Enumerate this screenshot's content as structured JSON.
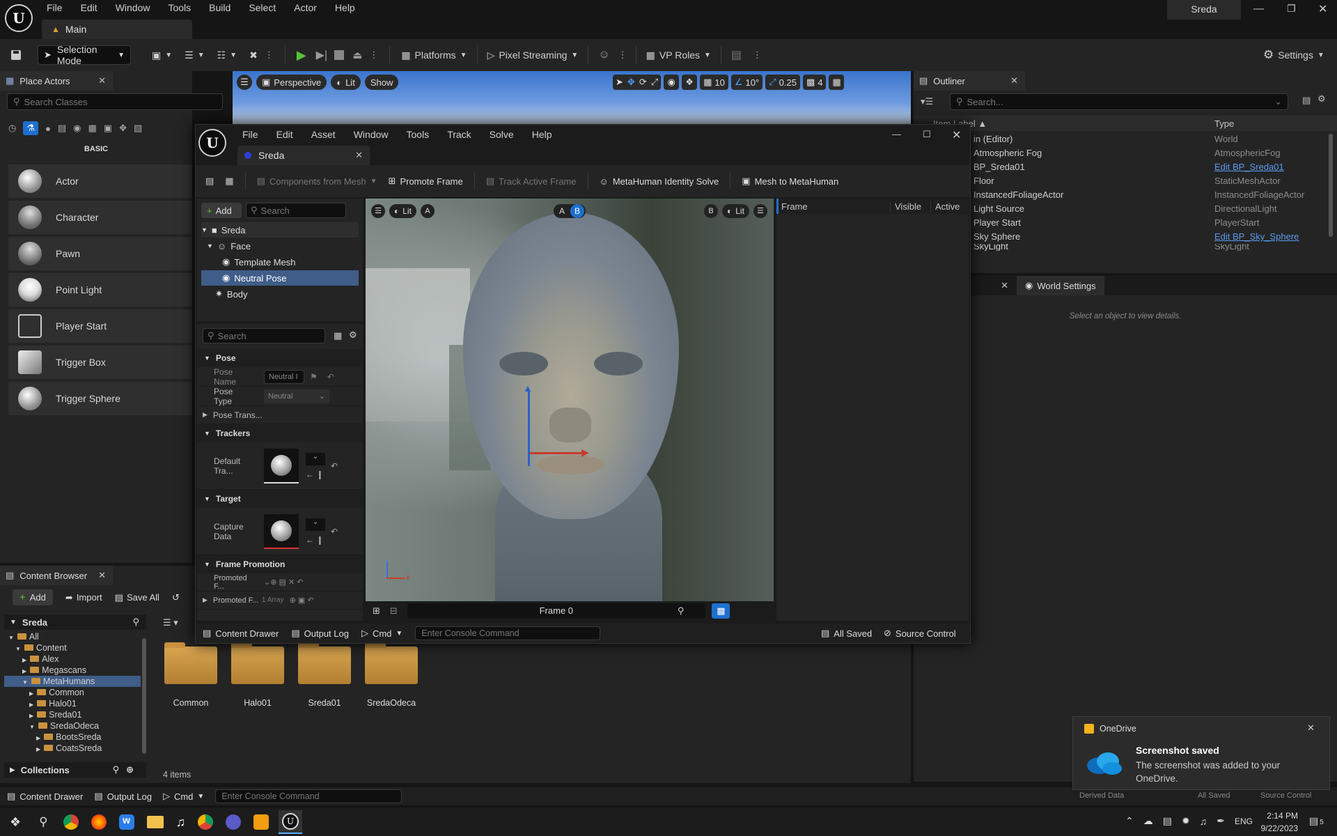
{
  "menubar": {
    "items": [
      "File",
      "Edit",
      "Window",
      "Tools",
      "Build",
      "Select",
      "Actor",
      "Help"
    ],
    "project": "Sreda"
  },
  "tab": {
    "label": "Main"
  },
  "toolbar": {
    "mode": "Selection Mode",
    "platforms": "Platforms",
    "pixel": "Pixel Streaming",
    "vp": "VP Roles",
    "settings": "Settings"
  },
  "viewport": {
    "perspective": "Perspective",
    "lit": "Lit",
    "show": "Show",
    "grid": "10",
    "angle": "10°",
    "scale": "0.25",
    "cam": "4"
  },
  "place": {
    "title": "Place Actors",
    "search": "Search Classes",
    "basic": "BASIC",
    "items": [
      "Actor",
      "Character",
      "Pawn",
      "Point Light",
      "Player Start",
      "Trigger Box",
      "Trigger Sphere"
    ]
  },
  "outliner": {
    "title": "Outliner",
    "search": "Search...",
    "col_label": "Item Label ▲",
    "col_type": "Type",
    "rows": [
      {
        "l": "in (Editor)",
        "t": "World",
        "link": false
      },
      {
        "l": "Atmospheric Fog",
        "t": "AtmosphericFog",
        "link": false
      },
      {
        "l": "BP_Sreda01",
        "t": "Edit BP_Sreda01",
        "link": true
      },
      {
        "l": "Floor",
        "t": "StaticMeshActor",
        "link": false
      },
      {
        "l": "InstancedFoliageActor",
        "t": "InstancedFoliageActor",
        "link": false
      },
      {
        "l": "Light Source",
        "t": "DirectionalLight",
        "link": false
      },
      {
        "l": "Player Start",
        "t": "PlayerStart",
        "link": false
      },
      {
        "l": "Sky Sphere",
        "t": "Edit BP_Sky_Sphere",
        "link": true
      },
      {
        "l": "SkyLight",
        "t": "SkyLight",
        "link": false
      }
    ]
  },
  "world": {
    "tab": "World Settings",
    "hint": "Select an object to view details."
  },
  "cb": {
    "title": "Content Browser",
    "add": "Add",
    "import": "Import",
    "save": "Save All",
    "root": "Sreda",
    "count": "4 items",
    "collections": "Collections",
    "tree": [
      {
        "n": "All",
        "d": 0
      },
      {
        "n": "Content",
        "d": 1
      },
      {
        "n": "Alex",
        "d": 2
      },
      {
        "n": "Megascans",
        "d": 2
      },
      {
        "n": "MetaHumans",
        "d": 2
      },
      {
        "n": "Common",
        "d": 3
      },
      {
        "n": "Halo01",
        "d": 3
      },
      {
        "n": "Sreda01",
        "d": 3
      },
      {
        "n": "SredaOdeca",
        "d": 3
      },
      {
        "n": "BootsSreda",
        "d": 4
      },
      {
        "n": "CoatsSreda",
        "d": 4
      }
    ],
    "folders": [
      "Common",
      "Halo01",
      "Sreda01",
      "SredaOdeca"
    ]
  },
  "bottombar": {
    "drawer": "Content Drawer",
    "log": "Output Log",
    "cmd": "Cmd",
    "console": "Enter Console Command",
    "derived": "Derived Data",
    "saved": "All Saved",
    "source": "Source Control"
  },
  "mh": {
    "menu": [
      "File",
      "Edit",
      "Asset",
      "Window",
      "Tools",
      "Track",
      "Solve",
      "Help"
    ],
    "tab": "Sreda",
    "components": "Components from Mesh",
    "promote": "Promote Frame",
    "track": "Track Active Frame",
    "identity": "MetaHuman Identity Solve",
    "mesh": "Mesh to MetaHuman",
    "add": "Add",
    "search": "Search",
    "tree": {
      "root": "Sreda",
      "face": "Face",
      "template": "Template Mesh",
      "neutral": "Neutral Pose",
      "body": "Body"
    },
    "details": {
      "search": "Search",
      "pose": "Pose",
      "pose_name": "Pose Name",
      "pose_name_val": "Neutral I",
      "pose_type": "Pose Type",
      "pose_type_val": "Neutral",
      "pose_trans": "Pose Trans...",
      "trackers": "Trackers",
      "default_tra": "Default Tra...",
      "target": "Target",
      "capture": "Capture Data",
      "frame_promo": "Frame Promotion",
      "promoted1": "Promoted F...",
      "promoted2": "Promoted F...",
      "array": "1 Array"
    },
    "vp": {
      "lit": "Lit",
      "a": "A",
      "b": "B",
      "frame": "Frame 0"
    },
    "frames": {
      "frame": "Frame",
      "visible": "Visible",
      "active": "Active"
    },
    "status": {
      "drawer": "Content Drawer",
      "log": "Output Log",
      "cmd": "Cmd",
      "console": "Enter Console Command",
      "saved": "All Saved",
      "source": "Source Control"
    }
  },
  "toast": {
    "app": "OneDrive",
    "title": "Screenshot saved",
    "body": "The screenshot was added to your OneDrive."
  },
  "taskbar": {
    "lang": "ENG",
    "time": "2:14 PM",
    "date": "9/22/2023",
    "notif": "5"
  }
}
